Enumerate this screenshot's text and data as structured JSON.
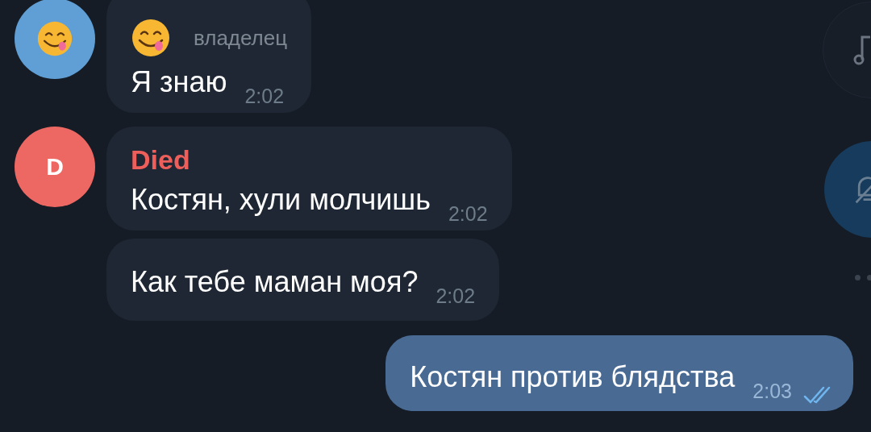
{
  "messages": [
    {
      "kind": "incoming",
      "avatar": {
        "kind": "emoji",
        "color": "#5f9fd6"
      },
      "sender": {
        "kind": "emoji",
        "role": "владелец"
      },
      "text": "Я знаю",
      "time": "2:02"
    },
    {
      "kind": "incoming",
      "avatar": {
        "kind": "letter",
        "letter": "D",
        "color": "#ee6863"
      },
      "sender": {
        "kind": "name",
        "name": "Died",
        "color": "#ee5e5a"
      },
      "text": "Костян, хули молчишь",
      "time": "2:02"
    },
    {
      "kind": "incoming",
      "text": "Как тебе маман моя?",
      "time": "2:02"
    },
    {
      "kind": "outgoing",
      "text": "Костян против блядства",
      "time": "2:03",
      "read": true
    }
  ],
  "side_buttons": [
    {
      "kind": "music"
    },
    {
      "kind": "unmute"
    }
  ]
}
